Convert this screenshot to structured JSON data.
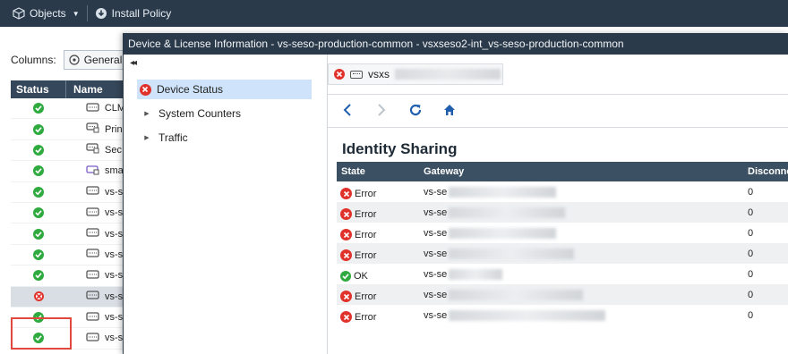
{
  "topbar": {
    "objects_label": "Objects",
    "install_label": "Install Policy"
  },
  "bg_panel": {
    "columns_label": "Columns:",
    "columns_value": "General",
    "headers": {
      "status": "Status",
      "name": "Name"
    },
    "rows": [
      {
        "status": "ok",
        "name": "CLM",
        "icon": "gateway-icon"
      },
      {
        "status": "ok",
        "name": "Prin",
        "icon": "server-icon"
      },
      {
        "status": "ok",
        "name": "Sec",
        "icon": "server-icon"
      },
      {
        "status": "ok",
        "name": "sma",
        "icon": "smart-icon"
      },
      {
        "status": "ok",
        "name": "vs-s",
        "icon": "gateway-icon"
      },
      {
        "status": "ok",
        "name": "vs-s",
        "icon": "gateway-icon"
      },
      {
        "status": "ok",
        "name": "vs-s",
        "icon": "gateway-icon"
      },
      {
        "status": "ok",
        "name": "vs-s",
        "icon": "gateway-icon"
      },
      {
        "status": "ok",
        "name": "vs-s",
        "icon": "gateway-icon"
      },
      {
        "status": "error",
        "name": "vs-s",
        "icon": "gateway-icon"
      },
      {
        "status": "ok",
        "name": "vs-s",
        "icon": "gateway-icon"
      },
      {
        "status": "ok",
        "name": "vs-s",
        "icon": "gateway-icon"
      }
    ]
  },
  "dialog": {
    "title": "Device & License Information - vs-seso-production-common - vsxseso2-int_vs-seso-production-common",
    "tree": [
      {
        "label": "Device Status",
        "active": true
      },
      {
        "label": "System Counters",
        "active": false
      },
      {
        "label": "Traffic",
        "active": false
      }
    ],
    "object_tab_label": "vsxs",
    "section_title": "Identity Sharing",
    "table": {
      "headers": {
        "state": "State",
        "gateway": "Gateway",
        "disconnect": "Disconnec"
      },
      "rows": [
        {
          "state": "Error",
          "gateway": "vs-se",
          "disconnect": "0"
        },
        {
          "state": "Error",
          "gateway": "vs-se",
          "disconnect": "0"
        },
        {
          "state": "Error",
          "gateway": "vs-se",
          "disconnect": "0"
        },
        {
          "state": "Error",
          "gateway": "vs-se",
          "disconnect": "0"
        },
        {
          "state": "OK",
          "gateway": "vs-se",
          "disconnect": "0"
        },
        {
          "state": "Error",
          "gateway": "vs-se",
          "disconnect": "0"
        },
        {
          "state": "Error",
          "gateway": "vs-se",
          "disconnect": "0"
        }
      ]
    }
  },
  "colors": {
    "ok": "#2faa3f",
    "error": "#e0322a",
    "header_dark": "#2b3a4a",
    "selection": "#cfe4fa",
    "highlight_box": "#e0483e"
  }
}
